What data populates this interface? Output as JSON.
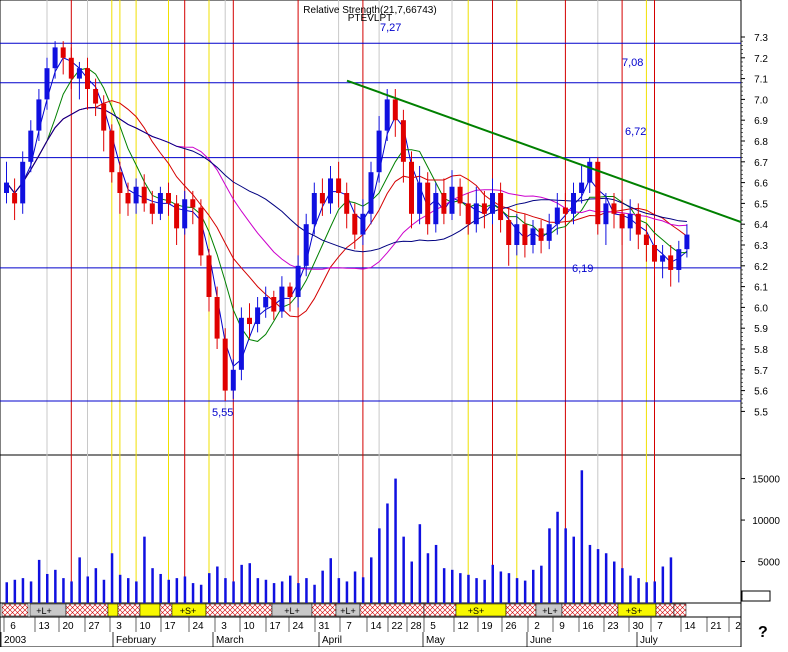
{
  "chart_data": {
    "type": "candlestick",
    "title_lines": [
      "Relative Strength(21,7,66743)",
      "PTEVLPT"
    ],
    "price_axis": {
      "min": 5.5,
      "max": 7.3,
      "ticks": [
        "7.3",
        "7.2",
        "7.1",
        "7.0",
        "6.9",
        "6.8",
        "6.7",
        "6.6",
        "6.5",
        "6.4",
        "6.3",
        "6.2",
        "6.1",
        "6.0",
        "5.9",
        "5.8",
        "5.7",
        "5.6",
        "5.5"
      ]
    },
    "volume_axis": {
      "min": 0,
      "max": 17000,
      "ticks": [
        "15000",
        "10000",
        "5000"
      ]
    },
    "date_axis": {
      "day_labels": [
        "6",
        "13",
        "20",
        "27",
        "3",
        "10",
        "17",
        "24",
        "3",
        "10",
        "17",
        "24",
        "31",
        "7",
        "14",
        "22",
        "28",
        "5",
        "12",
        "19",
        "26",
        "2",
        "9",
        "16",
        "23",
        "30",
        "7",
        "14",
        "21",
        "2"
      ],
      "month_labels": [
        "2003",
        "February",
        "March",
        "April",
        "May",
        "June",
        "July"
      ]
    },
    "annotations": {
      "levels": [
        "7,27",
        "7,08",
        "6,72",
        "6,19",
        "5,55"
      ],
      "level_values": [
        7.27,
        7.08,
        6.72,
        6.19,
        5.55
      ],
      "trendline": {
        "start_value": 7.09,
        "end_value": 6.41
      }
    },
    "candles": [
      [
        6.55,
        6.6,
        6.5,
        6.7,
        "blue"
      ],
      [
        6.55,
        6.5,
        6.42,
        6.62,
        "red"
      ],
      [
        6.5,
        6.7,
        6.45,
        6.75,
        "blue"
      ],
      [
        6.7,
        6.85,
        6.65,
        6.9,
        "blue"
      ],
      [
        6.85,
        7.0,
        6.8,
        7.05,
        "blue"
      ],
      [
        7.0,
        7.15,
        6.95,
        7.2,
        "blue"
      ],
      [
        7.15,
        7.25,
        7.1,
        7.28,
        "blue"
      ],
      [
        7.25,
        7.2,
        7.12,
        7.28,
        "red"
      ],
      [
        7.2,
        7.1,
        7.05,
        7.25,
        "red"
      ],
      [
        7.1,
        7.15,
        7.0,
        7.18,
        "blue"
      ],
      [
        7.15,
        7.05,
        6.95,
        7.2,
        "red"
      ],
      [
        7.05,
        6.98,
        6.92,
        7.1,
        "red"
      ],
      [
        6.98,
        6.85,
        6.75,
        7.02,
        "red"
      ],
      [
        6.85,
        6.65,
        6.6,
        6.88,
        "red"
      ],
      [
        6.65,
        6.55,
        6.45,
        6.7,
        "red"
      ],
      [
        6.55,
        6.5,
        6.44,
        6.6,
        "red"
      ],
      [
        6.5,
        6.58,
        6.45,
        6.62,
        "blue"
      ],
      [
        6.58,
        6.5,
        6.46,
        6.64,
        "red"
      ],
      [
        6.5,
        6.45,
        6.4,
        6.56,
        "red"
      ],
      [
        6.45,
        6.55,
        6.42,
        6.58,
        "blue"
      ],
      [
        6.55,
        6.5,
        6.44,
        6.6,
        "red"
      ],
      [
        6.5,
        6.38,
        6.3,
        6.54,
        "red"
      ],
      [
        6.38,
        6.52,
        6.35,
        6.56,
        "blue"
      ],
      [
        6.52,
        6.48,
        6.4,
        6.56,
        "red"
      ],
      [
        6.48,
        6.25,
        6.2,
        6.52,
        "red"
      ],
      [
        6.25,
        6.05,
        5.98,
        6.28,
        "red"
      ],
      [
        6.05,
        5.85,
        5.8,
        6.1,
        "red"
      ],
      [
        5.85,
        5.6,
        5.55,
        5.9,
        "red"
      ],
      [
        5.6,
        5.7,
        5.56,
        5.75,
        "blue"
      ],
      [
        5.7,
        5.95,
        5.65,
        6.0,
        "blue"
      ],
      [
        5.95,
        5.92,
        5.85,
        6.02,
        "red"
      ],
      [
        5.92,
        6.0,
        5.88,
        6.05,
        "blue"
      ],
      [
        6.0,
        6.05,
        5.95,
        6.1,
        "blue"
      ],
      [
        6.05,
        5.98,
        5.94,
        6.08,
        "red"
      ],
      [
        5.98,
        6.1,
        5.95,
        6.15,
        "blue"
      ],
      [
        6.1,
        6.05,
        5.98,
        6.12,
        "red"
      ],
      [
        6.05,
        6.2,
        6.0,
        6.25,
        "blue"
      ],
      [
        6.2,
        6.4,
        6.15,
        6.45,
        "blue"
      ],
      [
        6.4,
        6.55,
        6.35,
        6.6,
        "blue"
      ],
      [
        6.55,
        6.5,
        6.44,
        6.62,
        "red"
      ],
      [
        6.5,
        6.62,
        6.45,
        6.68,
        "blue"
      ],
      [
        6.62,
        6.55,
        6.48,
        6.7,
        "red"
      ],
      [
        6.55,
        6.45,
        6.38,
        6.6,
        "red"
      ],
      [
        6.45,
        6.35,
        6.28,
        6.5,
        "red"
      ],
      [
        6.35,
        6.45,
        6.3,
        6.52,
        "blue"
      ],
      [
        6.45,
        6.65,
        6.4,
        6.7,
        "blue"
      ],
      [
        6.65,
        6.85,
        6.6,
        6.92,
        "blue"
      ],
      [
        6.85,
        7.0,
        6.8,
        7.05,
        "blue"
      ],
      [
        7.0,
        6.9,
        6.82,
        7.05,
        "red"
      ],
      [
        6.9,
        6.7,
        6.6,
        6.95,
        "red"
      ],
      [
        6.7,
        6.45,
        6.38,
        6.75,
        "red"
      ],
      [
        6.45,
        6.6,
        6.4,
        6.68,
        "blue"
      ],
      [
        6.6,
        6.4,
        6.35,
        6.65,
        "red"
      ],
      [
        6.4,
        6.55,
        6.36,
        6.6,
        "blue"
      ],
      [
        6.55,
        6.45,
        6.4,
        6.62,
        "red"
      ],
      [
        6.45,
        6.58,
        6.42,
        6.66,
        "blue"
      ],
      [
        6.58,
        6.5,
        6.44,
        6.62,
        "red"
      ],
      [
        6.5,
        6.4,
        6.35,
        6.55,
        "red"
      ],
      [
        6.4,
        6.5,
        6.36,
        6.58,
        "blue"
      ],
      [
        6.5,
        6.45,
        6.38,
        6.56,
        "red"
      ],
      [
        6.45,
        6.55,
        6.4,
        6.62,
        "blue"
      ],
      [
        6.55,
        6.42,
        6.36,
        6.6,
        "red"
      ],
      [
        6.42,
        6.3,
        6.2,
        6.48,
        "red"
      ],
      [
        6.3,
        6.4,
        6.25,
        6.45,
        "blue"
      ],
      [
        6.4,
        6.3,
        6.24,
        6.45,
        "red"
      ],
      [
        6.3,
        6.38,
        6.26,
        6.42,
        "blue"
      ],
      [
        6.38,
        6.32,
        6.26,
        6.42,
        "red"
      ],
      [
        6.32,
        6.4,
        6.28,
        6.45,
        "blue"
      ],
      [
        6.4,
        6.48,
        6.35,
        6.55,
        "blue"
      ],
      [
        6.48,
        6.45,
        6.4,
        6.55,
        "red"
      ],
      [
        6.45,
        6.55,
        6.4,
        6.6,
        "blue"
      ],
      [
        6.55,
        6.6,
        6.5,
        6.68,
        "blue"
      ],
      [
        6.6,
        6.7,
        6.55,
        6.72,
        "blue"
      ],
      [
        6.7,
        6.4,
        6.35,
        6.72,
        "red"
      ],
      [
        6.4,
        6.5,
        6.3,
        6.55,
        "blue"
      ],
      [
        6.5,
        6.45,
        6.38,
        6.55,
        "red"
      ],
      [
        6.45,
        6.38,
        6.3,
        6.52,
        "red"
      ],
      [
        6.38,
        6.45,
        6.32,
        6.52,
        "blue"
      ],
      [
        6.45,
        6.35,
        6.28,
        6.5,
        "red"
      ],
      [
        6.35,
        6.3,
        6.22,
        6.4,
        "red"
      ],
      [
        6.3,
        6.22,
        6.15,
        6.35,
        "red"
      ],
      [
        6.22,
        6.25,
        6.14,
        6.3,
        "blue"
      ],
      [
        6.25,
        6.18,
        6.1,
        6.3,
        "red"
      ],
      [
        6.18,
        6.28,
        6.12,
        6.32,
        "blue"
      ],
      [
        6.28,
        6.35,
        6.24,
        6.4,
        "blue"
      ]
    ],
    "volume": [
      2500,
      2800,
      3000,
      2600,
      5200,
      3500,
      4000,
      3000,
      2600,
      5500,
      3200,
      4200,
      2800,
      6000,
      3400,
      3000,
      2600,
      8000,
      4200,
      3500,
      2800,
      3000,
      3200,
      2400,
      2200,
      3600,
      4400,
      3000,
      2600,
      4600,
      4800,
      3000,
      2800,
      2400,
      2600,
      3300,
      2400,
      3000,
      2200,
      3900,
      5400,
      3000,
      2600,
      3800,
      3100,
      5500,
      9000,
      12000,
      15000,
      8000,
      5000,
      9500,
      6000,
      7000,
      4200,
      4000,
      3600,
      3400,
      3000,
      2800,
      4600,
      3800,
      3600,
      3000,
      2700,
      4000,
      4500,
      9000,
      11000,
      9000,
      8000,
      16000,
      7000,
      6500,
      6000,
      5000,
      4200,
      3300,
      3000,
      2500,
      2600,
      4400,
      5500
    ],
    "signal_bar": {
      "labels": [
        "+L+",
        "+S+",
        "+L+",
        "+L+",
        "+S+",
        "+L+",
        "+S+"
      ]
    }
  },
  "help_icon": "?"
}
